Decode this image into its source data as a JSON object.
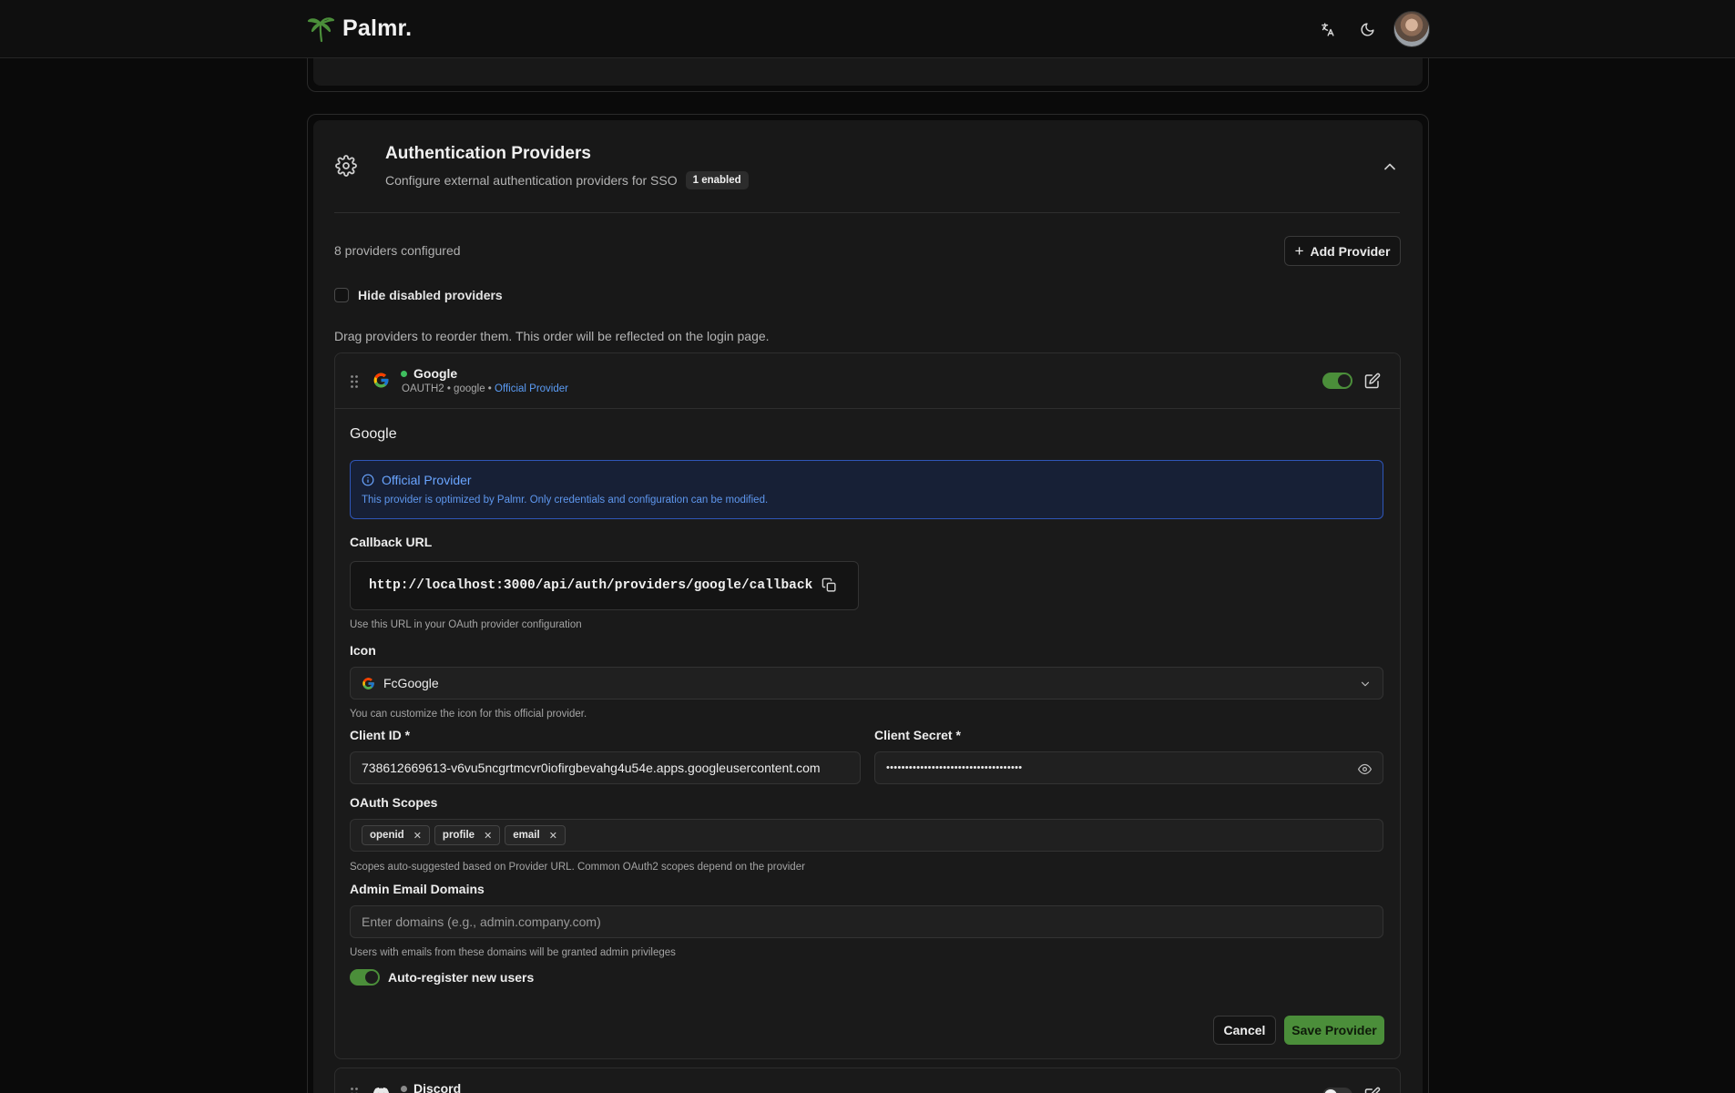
{
  "app": {
    "name": "Palmr."
  },
  "colors": {
    "accent_green": "#4b8e3a",
    "info_blue": "#5b9cf5",
    "status_enabled": "#3fbf5f"
  },
  "header": {
    "icons": [
      "translate-icon",
      "moon-icon"
    ],
    "avatar_alt": "user avatar"
  },
  "section": {
    "title": "Authentication Providers",
    "subtitle": "Configure external authentication providers for SSO",
    "badge": "1 enabled",
    "count_text": "8 providers configured",
    "add_button": "Add Provider",
    "hide_disabled_label": "Hide disabled providers",
    "hide_disabled_checked": false,
    "drag_hint": "Drag providers to reorder them. This order will be reflected on the login page."
  },
  "provider": {
    "name": "Google",
    "enabled": true,
    "meta_prefix": "OAUTH2 • google • ",
    "meta_official": "Official Provider",
    "form_title": "Google",
    "info_title": "Official Provider",
    "info_text": "This provider is optimized by Palmr. Only credentials and configuration can be modified.",
    "callback_label": "Callback URL",
    "callback_url": "http://localhost:3000/api/auth/providers/google/callback",
    "callback_help": "Use this URL in your OAuth provider configuration",
    "icon_label": "Icon",
    "icon_value": "FcGoogle",
    "icon_help": "You can customize the icon for this official provider.",
    "client_id_label": "Client ID *",
    "client_id_value": "738612669613-v6vu5ncgrtmcvr0iofirgbevahg4u54e.apps.googleusercontent.com",
    "client_secret_label": "Client Secret *",
    "client_secret_value": "••••••••••••••••••••••••••••••••••••",
    "scopes_label": "OAuth Scopes",
    "scopes": [
      "openid",
      "profile",
      "email"
    ],
    "scopes_help": "Scopes auto-suggested based on Provider URL. Common OAuth2 scopes depend on the provider",
    "admin_domains_label": "Admin Email Domains",
    "admin_domains_placeholder": "Enter domains (e.g., admin.company.com)",
    "admin_domains_help": "Users with emails from these domains will be granted admin privileges",
    "auto_register_label": "Auto-register new users",
    "auto_register_enabled": true,
    "cancel_button": "Cancel",
    "save_button": "Save Provider"
  },
  "next_provider": {
    "name": "Discord",
    "enabled": false
  }
}
